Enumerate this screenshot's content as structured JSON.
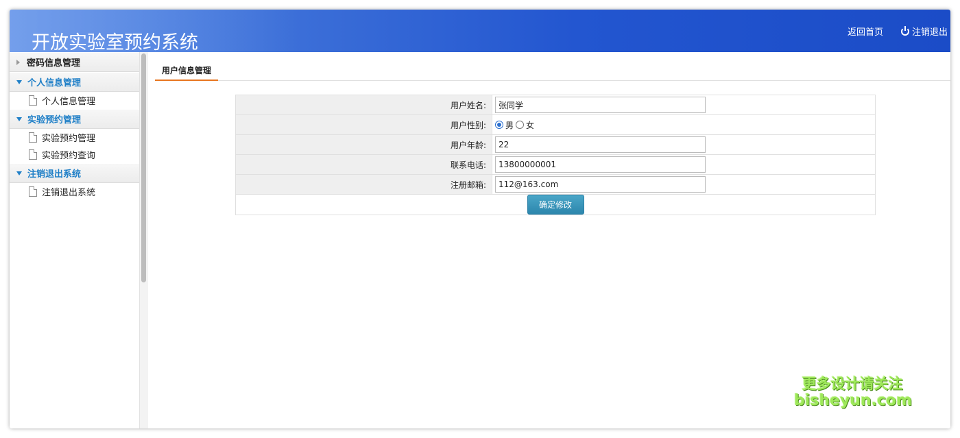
{
  "header": {
    "title": "开放实验室预约系统",
    "home_label": "返回首页",
    "logout_label": "注销退出"
  },
  "sidebar": {
    "groups": [
      {
        "label": "密码信息管理",
        "expanded": false,
        "items": []
      },
      {
        "label": "个人信息管理",
        "expanded": true,
        "items": [
          "个人信息管理"
        ]
      },
      {
        "label": "实验预约管理",
        "expanded": true,
        "items": [
          "实验预约管理",
          "实验预约查询"
        ]
      },
      {
        "label": "注销退出系统",
        "expanded": true,
        "items": [
          "注销退出系统"
        ]
      }
    ]
  },
  "main": {
    "tab_label": "用户信息管理",
    "form": {
      "name_label": "用户姓名:",
      "name_value": "张同学",
      "gender_label": "用户性别:",
      "gender_male": "男",
      "gender_female": "女",
      "gender_selected": "男",
      "age_label": "用户年龄:",
      "age_value": "22",
      "phone_label": "联系电话:",
      "phone_value": "13800000001",
      "email_label": "注册邮箱:",
      "email_value": "112@163.com",
      "submit_label": "确定修改"
    }
  },
  "watermark": {
    "line1": "更多设计请关注",
    "line2": "bisheyun.com"
  },
  "colors": {
    "header_blue": "#2356d0",
    "accent_blue": "#1f7fc7",
    "tab_underline": "#e8761f",
    "button": "#2c86ad"
  }
}
